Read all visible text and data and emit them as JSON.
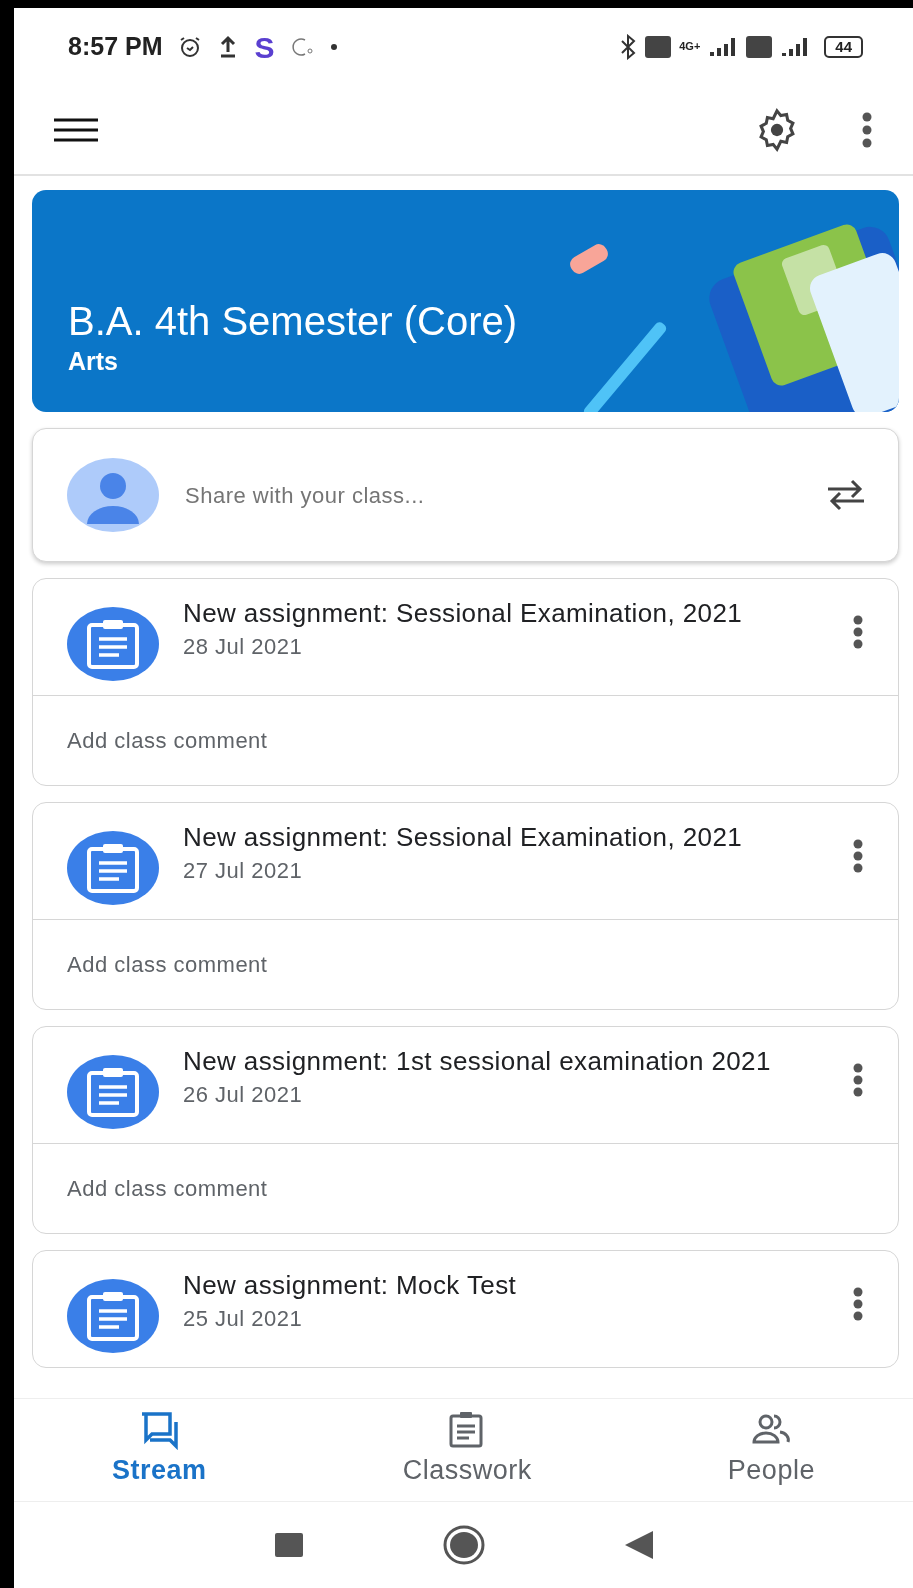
{
  "status_bar": {
    "time": "8:57 PM",
    "app_letter": "S",
    "network": "4G+",
    "battery": "44"
  },
  "class_banner": {
    "title": "B.A. 4th Semester (Core)",
    "section": "Arts"
  },
  "share_box": {
    "placeholder": "Share with your class..."
  },
  "posts": [
    {
      "title": "New assignment: Sessional Examination, 2021",
      "date": "28 Jul 2021",
      "comment_placeholder": "Add class comment"
    },
    {
      "title": "New assignment: Sessional Examination, 2021",
      "date": "27 Jul 2021",
      "comment_placeholder": "Add class comment"
    },
    {
      "title": "New assignment: 1st sessional examination 2021",
      "date": "26 Jul 2021",
      "comment_placeholder": "Add class comment"
    },
    {
      "title": "New assignment: Mock Test",
      "date": "25 Jul 2021"
    }
  ],
  "bottom_nav": [
    {
      "label": "Stream",
      "kind": "stream",
      "selected": true
    },
    {
      "label": "Classwork",
      "kind": "classwork",
      "selected": false
    },
    {
      "label": "People",
      "kind": "people",
      "selected": false
    }
  ]
}
